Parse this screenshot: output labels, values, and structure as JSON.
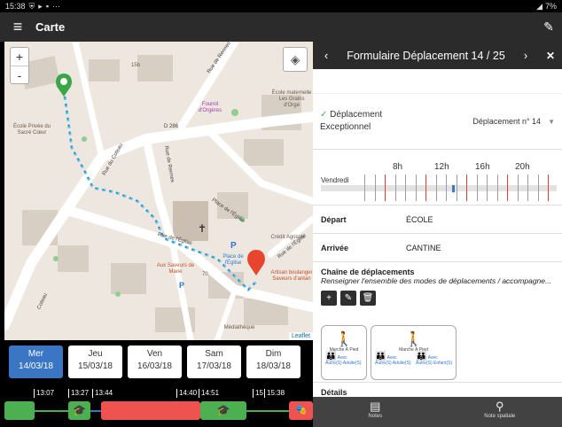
{
  "status_bar": {
    "time": "15:38",
    "battery": "7%"
  },
  "app": {
    "title": "Carte"
  },
  "map": {
    "labels": {
      "d286": "D 286",
      "rue_reines": "Rue de Rennes",
      "rue_coteau": "Rue du Coteau",
      "rue_reines2": "Rue de Rennes",
      "rue_eglise": "Rue de l'Église",
      "place_eglise": "Place de l'Église",
      "rue_eglise2": "Rue de l'Église",
      "ecole_privee": "École Privée du Sacré Cœur",
      "fournil": "Fournil d'Orgères",
      "ecole_maternelle": "École maternelle Les Grains d'Orge",
      "place_eglise_p": "Place de l'Église",
      "credit_agricole": "Crédit Agricole",
      "artisan": "Artisan boulanger Saveurs d'antan",
      "aux_saveurs": "Aux Saveurs de Marie",
      "mediatheque": "Médiathèque",
      "num_70": "70",
      "num_15": "15b",
      "coteau2": "Coteau"
    },
    "attribution": "Leaflet",
    "zoom_in": "+",
    "zoom_out": "-"
  },
  "days": [
    {
      "name": "Mer",
      "date": "14/03/18",
      "active": true
    },
    {
      "name": "Jeu",
      "date": "15/03/18",
      "active": false
    },
    {
      "name": "Ven",
      "date": "16/03/18",
      "active": false
    },
    {
      "name": "Sam",
      "date": "17/03/18",
      "active": false
    },
    {
      "name": "Dim",
      "date": "18/03/18",
      "active": false
    }
  ],
  "timeline": {
    "labels": [
      "13:07",
      "13:27",
      "13:44",
      "14:40",
      "14:51",
      "15",
      "15:38"
    ],
    "colors": {
      "green": "#4caf50",
      "red": "#ef5350",
      "blue": "#3a76c4",
      "black": "#1b1b1b"
    }
  },
  "form": {
    "title": "Formulaire Déplacement 14 / 25",
    "deplacement_label": "Déplacement",
    "deplacement_sub": "Exceptionnel",
    "deplacement_select": "Déplacement n° 14",
    "hours": [
      "8h",
      "12h",
      "16h",
      "20h"
    ],
    "day_label": "Vendredi",
    "depart_key": "Départ",
    "depart_value": "ÉCOLE",
    "arrivee_key": "Arrivée",
    "arrivee_value": "CANTINE",
    "chain_title": "Chaîne de déplacements",
    "chain_sub": "Renseigner l'ensemble des modes de déplacements / accompagne...",
    "card1": {
      "mode": "Marche À Pied",
      "comp1": "Avec Autre(S) Adulte(S)"
    },
    "card2": {
      "mode": "Marche À Pied",
      "comp1": "Avec Autre(S) Adulte(S)",
      "comp2": "Avec Autre(S) Enfant(S)"
    },
    "details_title": "Détails",
    "nav_notes": "Notes",
    "nav_spatial": "Note spatiale"
  }
}
